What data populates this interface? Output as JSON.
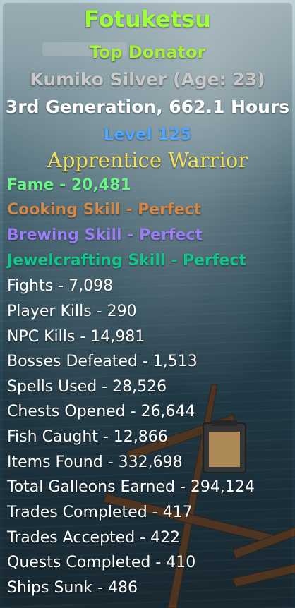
{
  "profile": {
    "name": "Fotuketsu",
    "rank": "Top Donator",
    "real_name": "Kumiko Silver (Age: 23)",
    "generation": "3rd Generation, 662.1 Hours",
    "level": "Level 125",
    "class_title": "Apprentice Warrior"
  },
  "highlights": {
    "fame": "Fame - 20,481",
    "cooking": "Cooking Skill - Perfect",
    "brewing": "Brewing Skill - Perfect",
    "jewelcrafting": "Jewelcrafting Skill - Perfect"
  },
  "stats": [
    "Fights - 7,098",
    "Player Kills - 290",
    "NPC Kills - 14,981",
    "Bosses Defeated - 1,513",
    "Spells Used - 28,526",
    "Chests Opened - 26,644",
    "Fish Caught - 12,866",
    "Items Found - 332,698",
    "Total Galleons Earned - 294,124",
    "Trades Completed - 417",
    "Trades Accepted - 422",
    "Quests Completed - 410",
    "Ships Sunk - 486"
  ],
  "colors": {
    "name": "#9dff35",
    "rank": "#a6f23a",
    "real_name": "#c9c9c9",
    "generation": "#ffffff",
    "level": "#4da6ff",
    "class_title": "#f2e05a",
    "fame": "#6cf58a",
    "cooking": "#d1884a",
    "brewing": "#9a7cf5",
    "jewelcrafting": "#14c58b",
    "stat_text": "#ffffff"
  }
}
